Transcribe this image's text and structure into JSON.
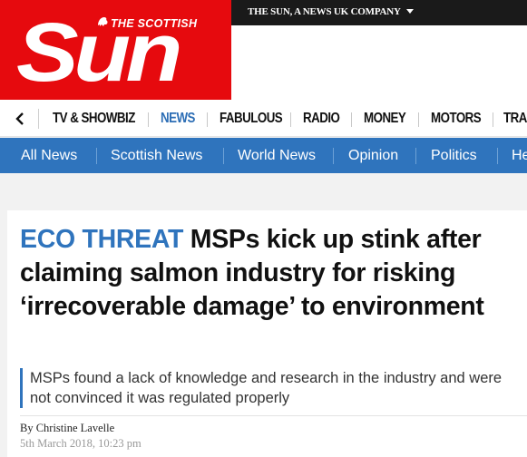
{
  "topbar": {
    "corporate_link": "THE SUN, A NEWS UK COMPANY"
  },
  "logo": {
    "the_scottish": "THE SCOTTISH",
    "sun": "Sun"
  },
  "section_nav": {
    "items": [
      {
        "label": "TV & SHOWBIZ"
      },
      {
        "label": "NEWS",
        "active": true
      },
      {
        "label": "FABULOUS"
      },
      {
        "label": "RADIO"
      },
      {
        "label": "MONEY"
      },
      {
        "label": "MOTORS"
      },
      {
        "label": "TRA"
      }
    ]
  },
  "subnav": {
    "items": [
      {
        "label": "All News"
      },
      {
        "label": "Scottish News"
      },
      {
        "label": "World News"
      },
      {
        "label": "Opinion"
      },
      {
        "label": "Politics"
      },
      {
        "label": "He"
      }
    ]
  },
  "article": {
    "kicker": "ECO THREAT",
    "headline": " MSPs kick up stink after claiming salmon industry for risking ‘irrecoverable damage’ to environment",
    "standfirst": "MSPs found a lack of knowledge and research in the industry and were not convinced it was regulated properly",
    "byline": "By Christine Lavelle",
    "date": "5th March 2018, 10:23 pm"
  },
  "colors": {
    "brand_red": "#e60a0e",
    "accent_blue": "#2f74bd",
    "topbar": "#1a1a1a"
  }
}
